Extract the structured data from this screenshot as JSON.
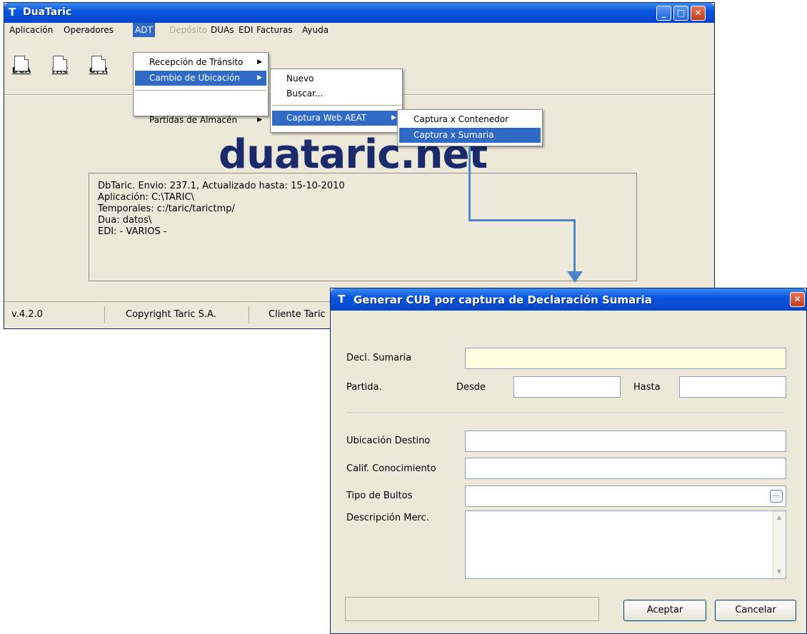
{
  "main_window": {
    "title": "DuaTaric",
    "app_icon": "T",
    "controls": {
      "minimize": "minimize-icon",
      "maximize": "maximize-icon",
      "close": "close-icon"
    },
    "menu": [
      "Aplicación",
      "Operadores",
      "ADT",
      "Depósito",
      "DUAs",
      "EDI",
      "Facturas",
      "Ayuda"
    ],
    "toolbar": [
      "DUA",
      "FAC",
      "OPR"
    ],
    "logo": "duataric.net",
    "info_lines": [
      "DbTaric. Envio: 237.1, Actualizado hasta: 15-10-2010",
      "Aplicación: C:\\TARIC\\",
      "Temporales: c:/taric/tarictmp/",
      "Dua: datos\\",
      "EDI: - VARIOS -"
    ],
    "status": {
      "version": "v.4.2.0",
      "copyright": "Copyright Taric S.A.",
      "client": "Cliente Taric"
    }
  },
  "adt_menu": {
    "items": [
      "Recepción de Tránsito",
      "Cambio de Ubicación",
      "Partidas de Almacén"
    ],
    "highlighted": "Cambio de Ubicación"
  },
  "cambio_submenu": {
    "items": [
      "Nuevo",
      "Buscar...",
      "Captura Web AEAT"
    ],
    "highlighted": "Captura Web AEAT"
  },
  "captura_submenu": {
    "items": [
      "Captura x Contenedor",
      "Captura x Sumaria"
    ],
    "highlighted": "Captura x Sumaria"
  },
  "dialog": {
    "title": "Generar CUB por captura de Declaración Sumaria",
    "labels": {
      "decl_sumaria": "Decl. Sumaria",
      "partida": "Partida.",
      "desde": "Desde",
      "hasta": "Hasta",
      "ubicacion_destino": "Ubicación Destino",
      "calif_conocimiento": "Calif. Conocimiento",
      "tipo_bultos": "Tipo de Bultos",
      "descripcion": "Descripción Merc."
    },
    "ellipsis": "...",
    "buttons": {
      "accept": "Aceptar",
      "cancel": "Cancelar"
    }
  },
  "colors": {
    "titlebar": "#0a55e0",
    "highlight": "#316ac5",
    "connector": "#4a86c8",
    "window_bg": "#ece9d8"
  }
}
